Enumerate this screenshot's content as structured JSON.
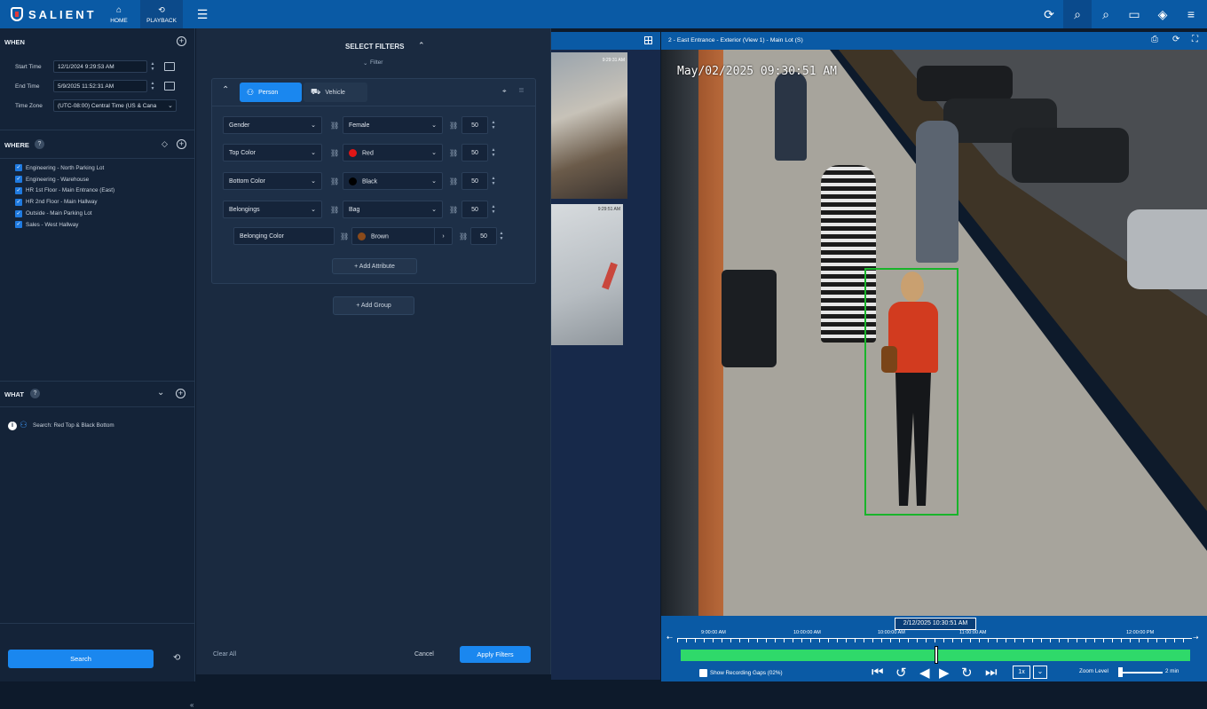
{
  "app": {
    "logo_text": "SALIENT",
    "nav": [
      {
        "label": "HOME",
        "icon": "home-icon"
      },
      {
        "label": "PLAYBACK",
        "icon": "playback-icon"
      }
    ]
  },
  "when": {
    "title": "WHEN",
    "start_label": "Start Time",
    "start_value": "12/1/2024 9:29:53 AM",
    "end_label": "End Time",
    "end_value": "5/9/2025 11:52:31 AM",
    "tz_label": "Time Zone",
    "tz_value": "(UTC-08:00) Central Time (US & Cana"
  },
  "where": {
    "title": "WHERE",
    "help": "?",
    "cameras": [
      "Engineering - North Parking Lot",
      "Engineering - Warehouse",
      "HR 1st Floor - Main Entrance (East)",
      "HR 2nd Floor - Main Hallway",
      "Outside - Main Parking Lot",
      "Sales - West Hallway"
    ]
  },
  "what": {
    "title": "WHAT",
    "help": "?",
    "search_text": "Search: Red Top & Black Bottom"
  },
  "footer": {
    "search_label": "Search"
  },
  "filters": {
    "title": "SELECT FILTERS",
    "subtitle": "Filter",
    "tab_person": "Person",
    "tab_vehicle": "Vehicle",
    "rows": [
      {
        "attribute": "Gender",
        "value": "Female",
        "threshold": "50",
        "color": ""
      },
      {
        "attribute": "Top Color",
        "value": "Red",
        "threshold": "50",
        "color": "#e01616"
      },
      {
        "attribute": "Bottom Color",
        "value": "Black",
        "threshold": "50",
        "color": "#000000"
      },
      {
        "attribute": "Belongings",
        "value": "Bag",
        "threshold": "50",
        "color": ""
      }
    ],
    "sub_row": {
      "attribute": "Belonging Color",
      "value": "Brown",
      "threshold": "50",
      "color": "#8a4a1a"
    },
    "add_attribute": "+ Add Attribute",
    "add_group": "+ Add Group",
    "clear_all": "Clear All",
    "cancel": "Cancel",
    "apply": "Apply Filters"
  },
  "thumbs": {
    "t1_time": "9:29:31 AM",
    "t2_time": "9:29:51 AM"
  },
  "video": {
    "title": "2 - East Entrance - Exterior (View 1) - Main Lot (S)",
    "overlay_time": "May/02/2025 09:30:51 AM"
  },
  "timeline": {
    "cursor_time": "2/12/2025 10:30:51 AM",
    "ticks": [
      "9:00:00 AM",
      "10:00:00 AM",
      "10:00:00 AM",
      "11:00:00 AM",
      "12:00:00 PM"
    ],
    "show_gaps": "Show Recording Gaps (02%)",
    "speed": "1x",
    "zoom_label": "Zoom Level",
    "zoom_value": "2 min"
  }
}
